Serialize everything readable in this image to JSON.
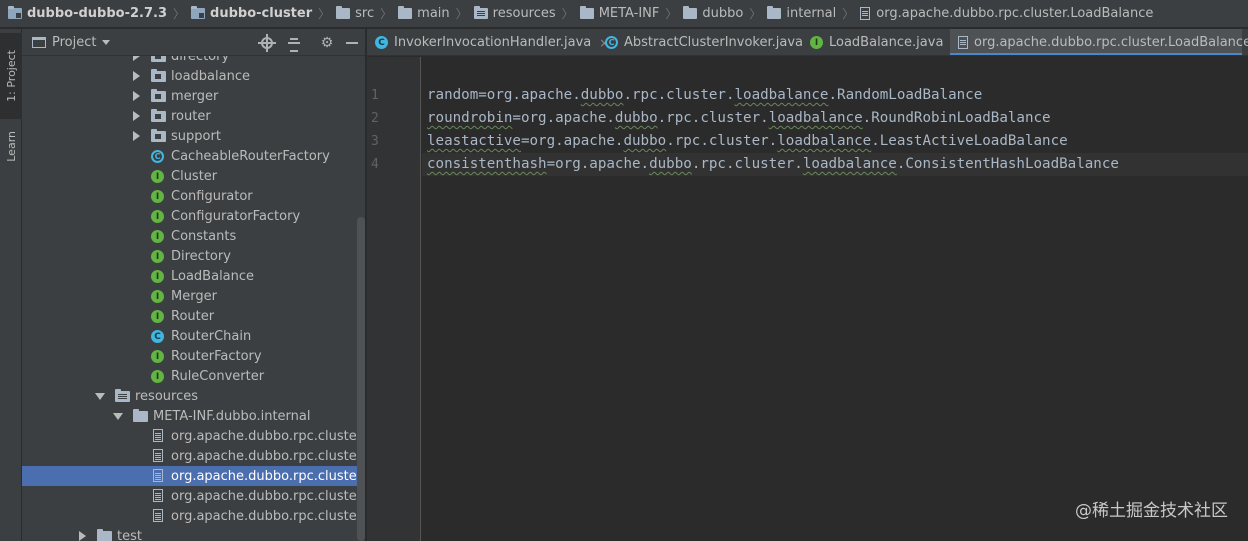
{
  "breadcrumb": {
    "items": [
      {
        "label": "dubbo-dubbo-2.7.3",
        "icon": "module-folder-icon",
        "bold": true
      },
      {
        "label": "dubbo-cluster",
        "icon": "module-folder-icon",
        "bold": true
      },
      {
        "label": "src",
        "icon": "folder-icon"
      },
      {
        "label": "main",
        "icon": "folder-icon"
      },
      {
        "label": "resources",
        "icon": "resources-folder-icon"
      },
      {
        "label": "META-INF",
        "icon": "folder-icon"
      },
      {
        "label": "dubbo",
        "icon": "folder-icon"
      },
      {
        "label": "internal",
        "icon": "folder-icon"
      },
      {
        "label": "org.apache.dubbo.rpc.cluster.LoadBalance",
        "icon": "file-icon"
      }
    ]
  },
  "left_stripe": {
    "project_label": "1: Project",
    "learn_label": "Learn"
  },
  "project_panel": {
    "title": "Project",
    "tree": [
      {
        "label": "directory",
        "type": "package",
        "expand": "collapsed",
        "depth": 4
      },
      {
        "label": "loadbalance",
        "type": "package",
        "expand": "collapsed",
        "depth": 4
      },
      {
        "label": "merger",
        "type": "package",
        "expand": "collapsed",
        "depth": 4
      },
      {
        "label": "router",
        "type": "package",
        "expand": "collapsed",
        "depth": 4
      },
      {
        "label": "support",
        "type": "package",
        "expand": "collapsed",
        "depth": 4
      },
      {
        "label": "CacheableRouterFactory",
        "type": "abstract-class",
        "depth": 4
      },
      {
        "label": "Cluster",
        "type": "interface",
        "depth": 4
      },
      {
        "label": "Configurator",
        "type": "interface",
        "depth": 4
      },
      {
        "label": "ConfiguratorFactory",
        "type": "interface",
        "depth": 4
      },
      {
        "label": "Constants",
        "type": "interface",
        "depth": 4
      },
      {
        "label": "Directory",
        "type": "interface",
        "depth": 4
      },
      {
        "label": "LoadBalance",
        "type": "interface",
        "depth": 4
      },
      {
        "label": "Merger",
        "type": "interface",
        "depth": 4
      },
      {
        "label": "Router",
        "type": "interface",
        "depth": 4
      },
      {
        "label": "RouterChain",
        "type": "class",
        "depth": 4
      },
      {
        "label": "RouterFactory",
        "type": "interface",
        "depth": 4
      },
      {
        "label": "RuleConverter",
        "type": "interface",
        "depth": 4
      },
      {
        "label": "resources",
        "type": "resources-folder",
        "expand": "expanded",
        "depth": 2
      },
      {
        "label": "META-INF.dubbo.internal",
        "type": "folder",
        "expand": "expanded",
        "depth": 3
      },
      {
        "label": "org.apache.dubbo.rpc.cluster.Clus",
        "type": "file",
        "depth": 4
      },
      {
        "label": "org.apache.dubbo.rpc.cluster.Con",
        "type": "file",
        "depth": 4
      },
      {
        "label": "org.apache.dubbo.rpc.cluster.Loa",
        "type": "file",
        "depth": 4,
        "selected": true
      },
      {
        "label": "org.apache.dubbo.rpc.cluster.Mer",
        "type": "file",
        "depth": 4
      },
      {
        "label": "org.apache.dubbo.rpc.cluster.Rou",
        "type": "file",
        "depth": 4
      },
      {
        "label": "test",
        "type": "folder",
        "expand": "collapsed",
        "depth": 1
      }
    ]
  },
  "editor": {
    "tabs": [
      {
        "label": "InvokerInvocationHandler.java",
        "icon": "class-icon"
      },
      {
        "label": "AbstractClusterInvoker.java",
        "icon": "abstract-class-icon"
      },
      {
        "label": "LoadBalance.java",
        "icon": "interface-icon"
      },
      {
        "label": "org.apache.dubbo.rpc.cluster.LoadBalance",
        "icon": "file-icon",
        "active": true
      }
    ],
    "close_glyph": "×",
    "lines": [
      {
        "number": "1",
        "segments": [
          {
            "text": "random=org.apache.",
            "typo": false
          },
          {
            "text": "dubbo",
            "typo": true
          },
          {
            "text": ".rpc.cluster.",
            "typo": false
          },
          {
            "text": "loadbalance",
            "typo": true
          },
          {
            "text": ".RandomLoadBalance",
            "typo": false
          }
        ]
      },
      {
        "number": "2",
        "segments": [
          {
            "text": "roundrobin",
            "typo": true
          },
          {
            "text": "=org.apache.",
            "typo": false
          },
          {
            "text": "dubbo",
            "typo": true
          },
          {
            "text": ".rpc.cluster.",
            "typo": false
          },
          {
            "text": "loadbalance",
            "typo": true
          },
          {
            "text": ".RoundRobinLoadBalance",
            "typo": false
          }
        ]
      },
      {
        "number": "3",
        "segments": [
          {
            "text": "leastactive",
            "typo": true
          },
          {
            "text": "=org.apache.",
            "typo": false
          },
          {
            "text": "dubbo",
            "typo": true
          },
          {
            "text": ".rpc.cluster.",
            "typo": false
          },
          {
            "text": "loadbalance",
            "typo": true
          },
          {
            "text": ".LeastActiveLoadBalance",
            "typo": false
          }
        ]
      },
      {
        "number": "4",
        "segments": [
          {
            "text": "consistenthash",
            "typo": true
          },
          {
            "text": "=org.apache.",
            "typo": false
          },
          {
            "text": "dubbo",
            "typo": true
          },
          {
            "text": ".rpc.cluster.",
            "typo": false
          },
          {
            "text": "loadbalance",
            "typo": true
          },
          {
            "text": ".ConsistentHashLoadBalance",
            "typo": false
          }
        ]
      }
    ],
    "current_line": 4
  },
  "watermark": "@稀土掘金技术社区",
  "colors": {
    "interface_icon": "#62b543",
    "class_icon": "#40b6e0",
    "selection": "#4b6eaf",
    "active_tab_underline": "#4a88c7",
    "typo_underline": "#6a8759"
  }
}
